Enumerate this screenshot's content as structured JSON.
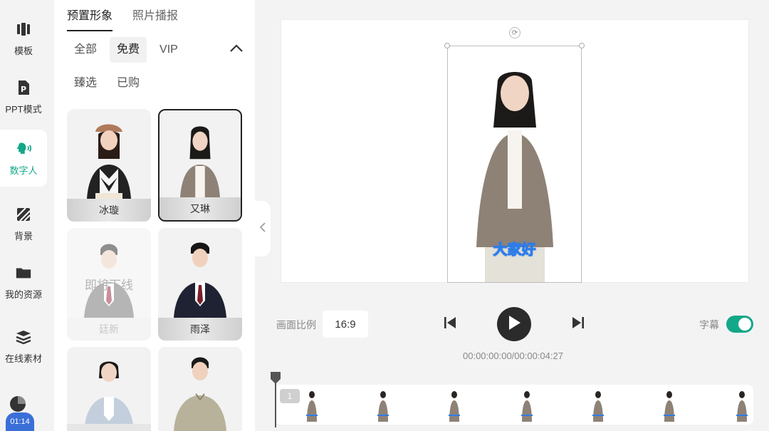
{
  "rail": {
    "items": [
      {
        "label": "模板",
        "icon": "template-icon"
      },
      {
        "label": "PPT模式",
        "icon": "ppt-icon"
      },
      {
        "label": "数字人",
        "icon": "digital-human-icon",
        "active": true
      },
      {
        "label": "背景",
        "icon": "background-icon"
      },
      {
        "label": "我的资源",
        "icon": "folder-icon"
      },
      {
        "label": "在线素材",
        "icon": "layers-icon"
      }
    ],
    "timer_badge": "01:14"
  },
  "panel": {
    "tabs": [
      {
        "label": "预置形象",
        "active": true
      },
      {
        "label": "照片播报",
        "active": false
      }
    ],
    "filters_row1": [
      "全部",
      "免费",
      "VIP"
    ],
    "filters_row2": [
      "臻选",
      "已购"
    ],
    "active_filter": "免费",
    "avatars": [
      {
        "name": "冰璇"
      },
      {
        "name": "又琳",
        "selected": true
      },
      {
        "name": "廷新",
        "overlay": "即将下线"
      },
      {
        "name": "雨泽"
      },
      {
        "name": ""
      },
      {
        "name": ""
      }
    ]
  },
  "canvas": {
    "subtitle": "大家好"
  },
  "controls": {
    "ratio_label": "画面比例",
    "ratio_value": "16:9",
    "time": "00:00:00:00/00:00:04:27",
    "subtitle_label": "字幕",
    "subtitle_on": true
  },
  "timeline": {
    "track_number": "1"
  },
  "colors": {
    "accent": "#12a889",
    "subtitle_stroke": "#2d7ce8",
    "badge": "#3b6fd8"
  }
}
